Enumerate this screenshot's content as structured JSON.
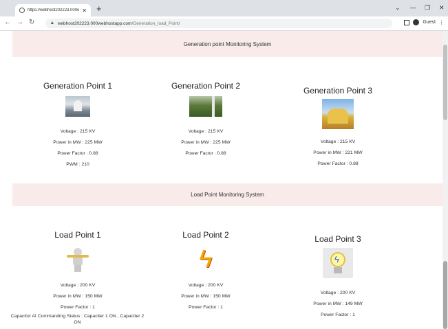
{
  "browser": {
    "tab_title": "https://webhost202223.000webt",
    "url_domain": "webhost202223.000webhostapp.com",
    "url_path": "/Generation_load_Point/",
    "profile_label": "Guest"
  },
  "generation": {
    "header": "Generation point Monitoring System",
    "cards": [
      {
        "title": "Generation Point 1",
        "voltage": "Voltage : 215 KV",
        "power": "Power in MW : 225 MW",
        "pf": "Power Factor : 0.88",
        "pwm": "PWM : 210"
      },
      {
        "title": "Generation Point 2",
        "voltage": "Voltage : 215 KV",
        "power": "Power in MW : 225 MW",
        "pf": "Power Factor : 0.88"
      },
      {
        "title": "Generation Point 3",
        "voltage": "Voltage : 215 KV",
        "power": "Power in MW : 221 MW",
        "pf": "Power Factor : 0.88"
      }
    ]
  },
  "load": {
    "header": "Load Point Monitoring System",
    "cards": [
      {
        "title": "Load Point 1",
        "voltage": "Voltage : 200 KV",
        "power": "Power in MW : 150 MW",
        "pf": "Power Factor : 1",
        "status": "Capacitor AI Commanding Status : Capaciter 1 ON , Capaciter 2 ON"
      },
      {
        "title": "Load Point 2",
        "voltage": "Voltage : 200 KV",
        "power": "Power in MW : 150 MW",
        "pf": "Power Factor : 1"
      },
      {
        "title": "Load Point 3",
        "voltage": "Voltage : 200 KV",
        "power": "Power in MW : 149 MW",
        "pf": "Power Factor : 1"
      }
    ]
  },
  "icons": {
    "tab": "globe-icon",
    "close_tab": "close-icon",
    "new_tab": "plus-icon",
    "back": "arrow-left-icon",
    "forward": "arrow-right-icon",
    "reload": "reload-icon",
    "lock": "lock-icon",
    "sidepanel": "sidepanel-icon",
    "profile": "profile-icon",
    "menu": "kebab-menu-icon",
    "load1": "electrician-icon",
    "load2": "lightning-bolt-icon",
    "load3": "light-bulb-icon"
  }
}
